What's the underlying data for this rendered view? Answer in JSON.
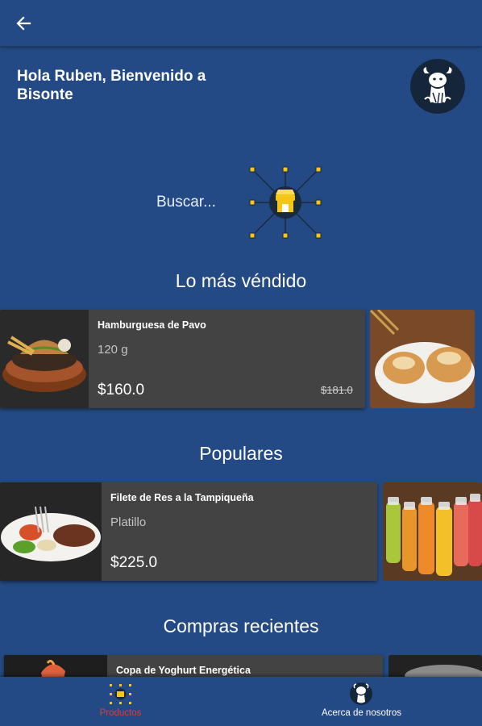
{
  "header": {
    "back_icon": "arrow-back-icon"
  },
  "greeting": {
    "line1": "Hola Ruben, Bienvenido a",
    "line2": "Bisonte"
  },
  "search": {
    "label": "Buscar...",
    "icon": "store-search-icon"
  },
  "sections": {
    "best_sellers": {
      "title": "Lo más véndido",
      "item": {
        "name": "Hamburguesa de Pavo",
        "detail": "120 g",
        "price": "$160.0",
        "old_price": "$181.0"
      }
    },
    "popular": {
      "title": "Populares",
      "item": {
        "name": "Filete de Res a la Tampiqueña",
        "detail": "Platillo",
        "price": "$225.0"
      }
    },
    "recent": {
      "title": "Compras recientes",
      "item": {
        "name": "Copa de Yoghurt Energética"
      }
    }
  },
  "bottom_nav": [
    {
      "label": "Productos",
      "active": true,
      "color": "#e53935"
    },
    {
      "label": "Acerca de nosotros",
      "active": false,
      "color": "#ffffff"
    }
  ],
  "colors": {
    "primary": "#234a84",
    "card": "#434343",
    "accent": "#f5c518"
  }
}
